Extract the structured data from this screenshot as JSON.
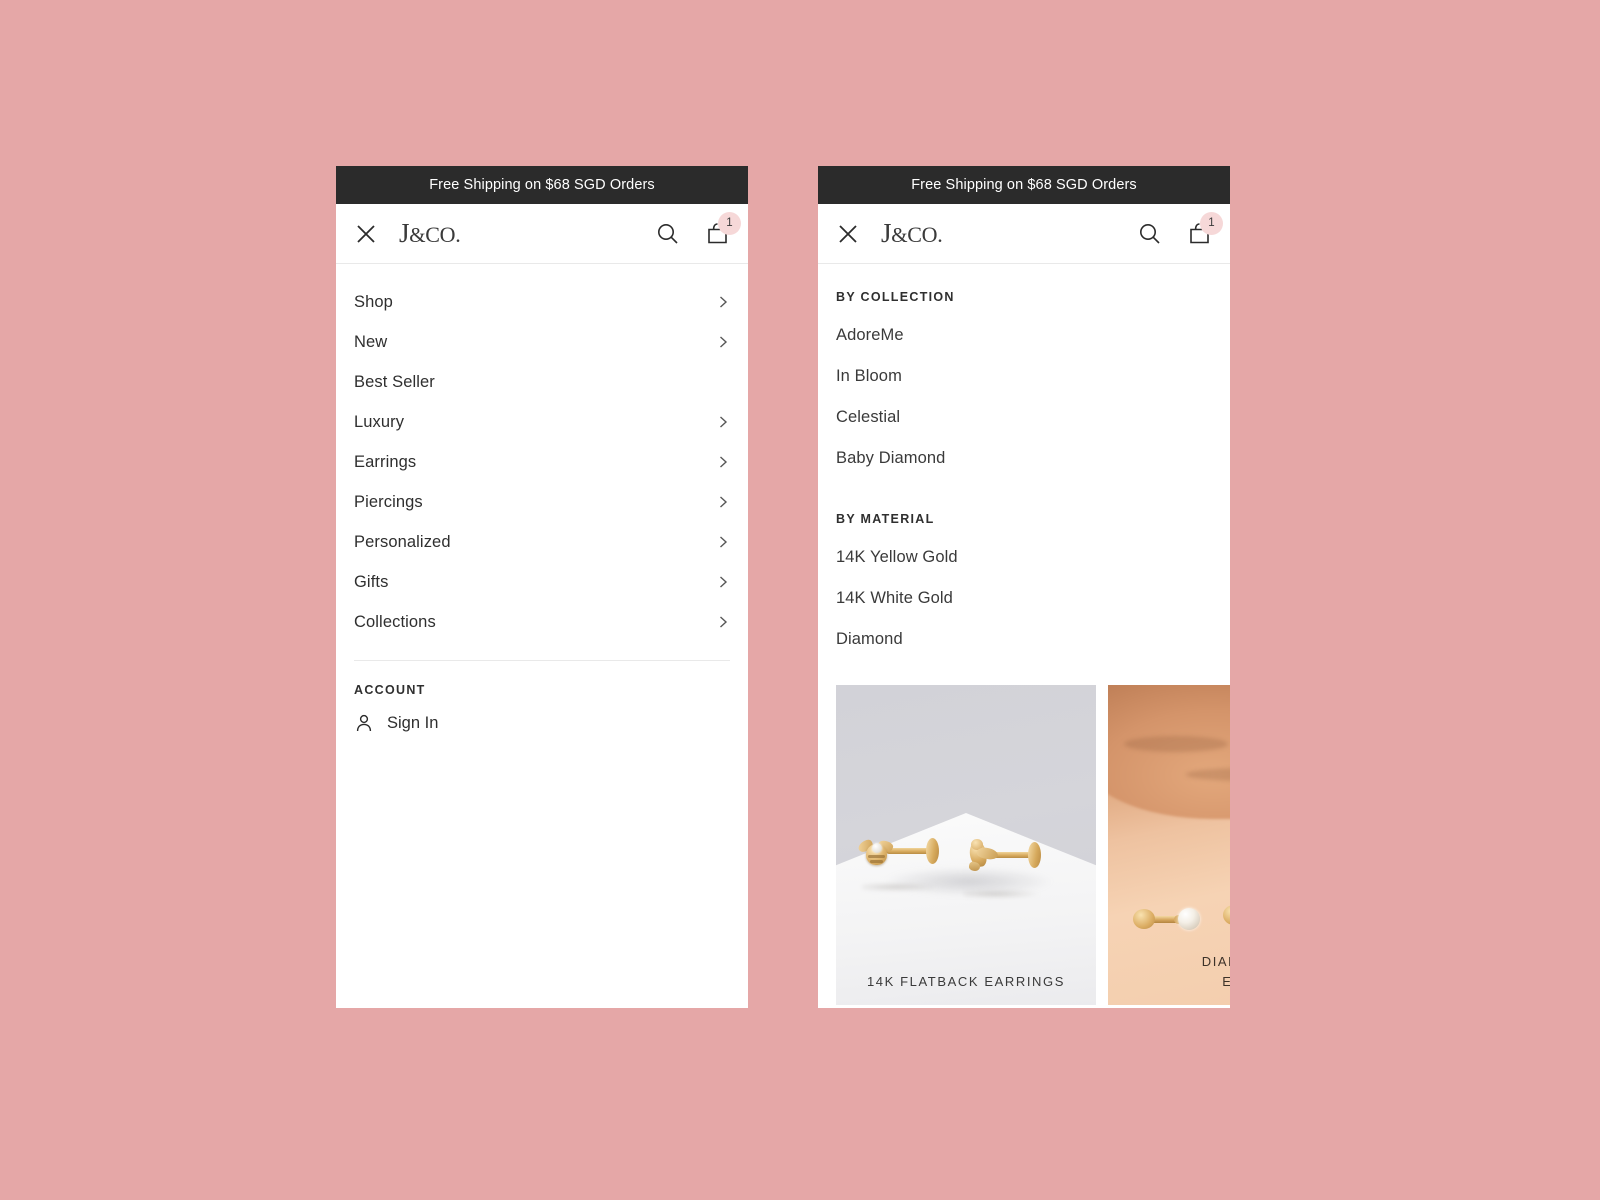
{
  "theme": {
    "page_background": "#e5a7a7",
    "banner_background": "#2b2b2b",
    "panel_background": "#ffffff",
    "badge_background": "#f6d8d8",
    "text_primary": "#2f2f2f"
  },
  "banner": {
    "text": "Free Shipping on $68 SGD Orders"
  },
  "header": {
    "close_icon": "close-icon",
    "logo_j": "J",
    "logo_amp": "&",
    "logo_co": "CO.",
    "search_icon": "search-icon",
    "cart_icon": "shopping-bag-icon",
    "cart_count": "1"
  },
  "left_panel": {
    "nav_items": [
      {
        "label": "Shop",
        "has_chevron": true
      },
      {
        "label": "New",
        "has_chevron": true
      },
      {
        "label": "Best Seller",
        "has_chevron": false
      },
      {
        "label": "Luxury",
        "has_chevron": true
      },
      {
        "label": "Earrings",
        "has_chevron": true
      },
      {
        "label": "Piercings",
        "has_chevron": true
      },
      {
        "label": "Personalized",
        "has_chevron": true
      },
      {
        "label": "Gifts",
        "has_chevron": true
      },
      {
        "label": "Collections",
        "has_chevron": true
      }
    ],
    "account_heading": "ACCOUNT",
    "sign_in_label": "Sign In",
    "person_icon": "person-icon"
  },
  "right_panel": {
    "collection_heading": "BY COLLECTION",
    "collection_items": [
      {
        "label": "AdoreMe"
      },
      {
        "label": "In Bloom"
      },
      {
        "label": "Celestial"
      },
      {
        "label": "Baby Diamond"
      }
    ],
    "material_heading": "BY MATERIAL",
    "material_items": [
      {
        "label": "14K Yellow Gold"
      },
      {
        "label": "14K White Gold"
      },
      {
        "label": "Diamond"
      }
    ],
    "cards": [
      {
        "caption": "14K FLATBACK EARRINGS",
        "image": "gold-flatback-earrings-photo"
      },
      {
        "caption": "DIAMOND",
        "caption_line2": "EAR",
        "image": "diamond-stud-earrings-photo"
      }
    ]
  }
}
